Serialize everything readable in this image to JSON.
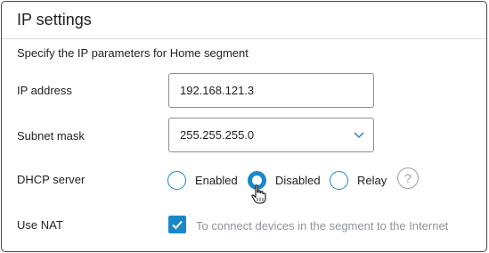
{
  "panel": {
    "title": "IP settings",
    "subtitle": "Specify the IP parameters for Home segment"
  },
  "ip_address": {
    "label": "IP address",
    "value": "192.168.121.3"
  },
  "subnet_mask": {
    "label": "Subnet mask",
    "value": "255.255.255.0"
  },
  "dhcp": {
    "label": "DHCP server",
    "options": [
      {
        "label": "Enabled",
        "selected": false
      },
      {
        "label": "Disabled",
        "selected": true
      },
      {
        "label": "Relay",
        "selected": false
      }
    ],
    "help": "?"
  },
  "nat": {
    "label": "Use NAT",
    "checked": true,
    "description": "To connect devices in the segment to the Internet"
  },
  "colors": {
    "accent": "#1a87c8",
    "border": "#4a4a4a",
    "muted_text": "#8f949a"
  }
}
